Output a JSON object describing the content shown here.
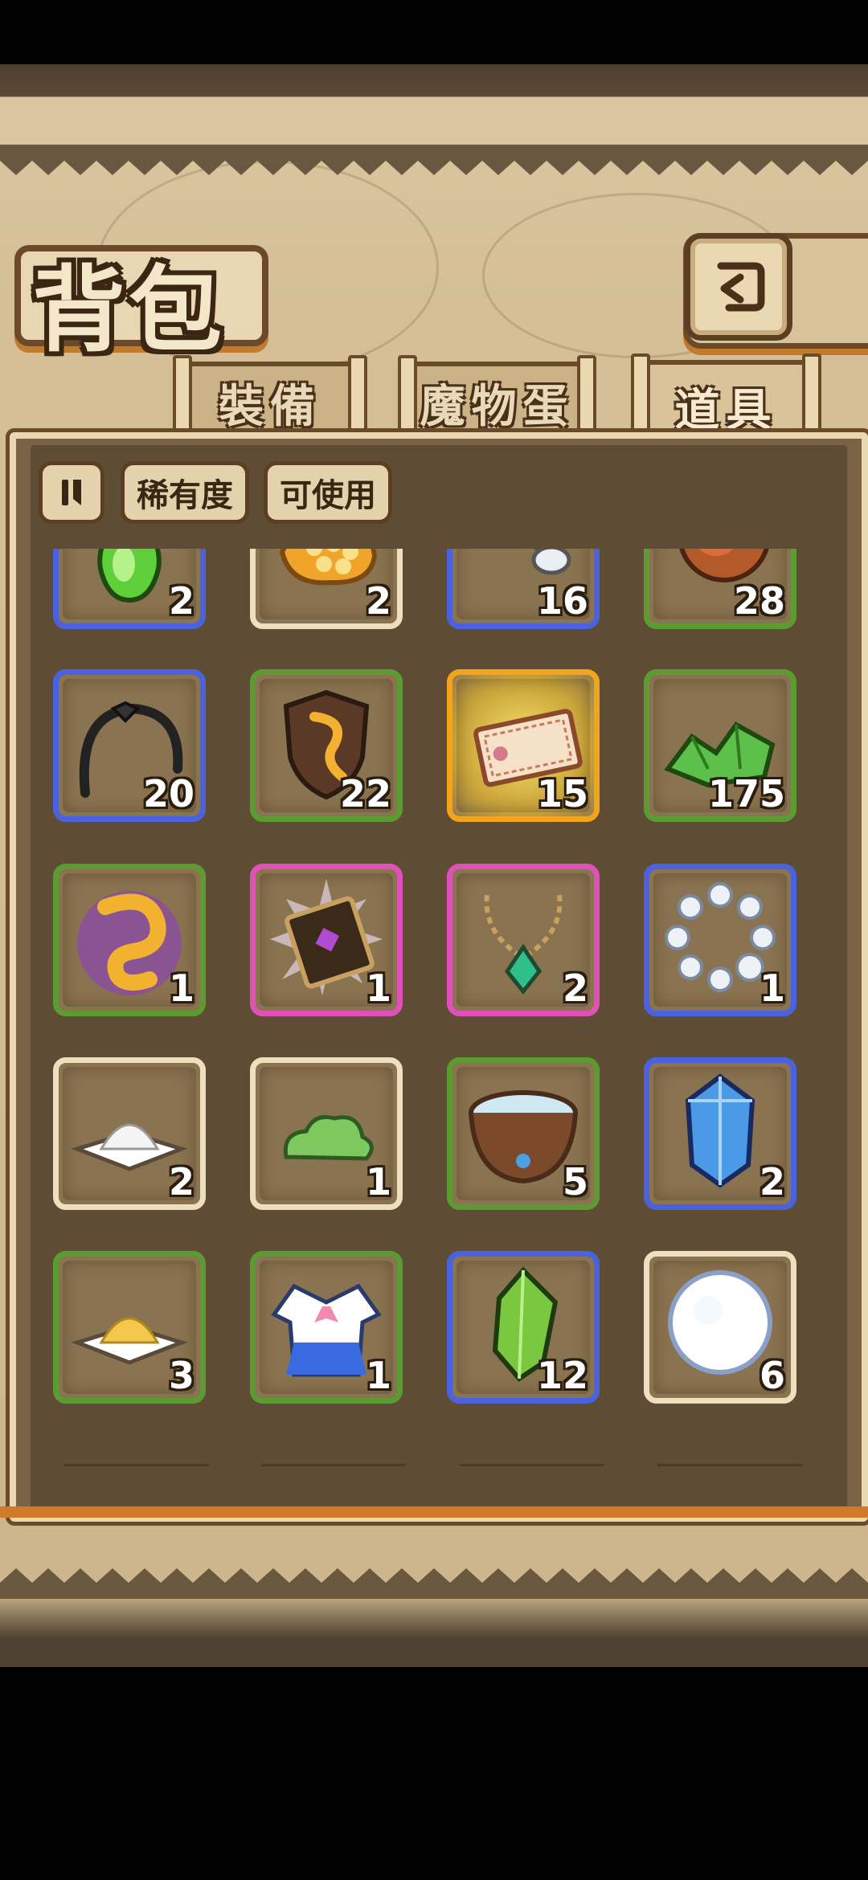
{
  "header": {
    "title": "背包",
    "back_icon": "return-arrow-icon"
  },
  "tabs": [
    {
      "label": "裝備",
      "active": false
    },
    {
      "label": "魔物蛋",
      "active": false
    },
    {
      "label": "道具",
      "active": true
    }
  ],
  "toolbar": {
    "pause_icon": "pause-sort-icon",
    "rarity_label": "稀有度",
    "usable_label": "可使用"
  },
  "rarity_colors": {
    "common": "#efe0bd",
    "uncommon": "#5c9b32",
    "rare": "#4a62e0",
    "epic": "#e051b8",
    "legendary": "#f2a51c"
  },
  "items": [
    {
      "icon": "green-gem-drop-icon",
      "qty": "2",
      "rarity": "rare"
    },
    {
      "icon": "honeycomb-icon",
      "qty": "2",
      "rarity": "common"
    },
    {
      "icon": "glasses-icon",
      "qty": "16",
      "rarity": "rare"
    },
    {
      "icon": "meat-slice-icon",
      "qty": "28",
      "rarity": "uncommon"
    },
    {
      "icon": "black-headband-icon",
      "qty": "20",
      "rarity": "rare"
    },
    {
      "icon": "dragon-shield-icon",
      "qty": "22",
      "rarity": "uncommon"
    },
    {
      "icon": "ticket-icon",
      "qty": "15",
      "rarity": "legendary"
    },
    {
      "icon": "green-crystals-icon",
      "qty": "175",
      "rarity": "uncommon"
    },
    {
      "icon": "golden-dragon-horn-icon",
      "qty": "1",
      "rarity": "uncommon"
    },
    {
      "icon": "magic-book-icon",
      "qty": "1",
      "rarity": "epic"
    },
    {
      "icon": "jade-necklace-icon",
      "qty": "2",
      "rarity": "epic"
    },
    {
      "icon": "pearl-bracelet-icon",
      "qty": "1",
      "rarity": "rare"
    },
    {
      "icon": "white-powder-icon",
      "qty": "2",
      "rarity": "common"
    },
    {
      "icon": "green-slime-icon",
      "qty": "1",
      "rarity": "common"
    },
    {
      "icon": "water-bowl-icon",
      "qty": "5",
      "rarity": "uncommon"
    },
    {
      "icon": "blue-crystal-icon",
      "qty": "2",
      "rarity": "rare"
    },
    {
      "icon": "yellow-powder-icon",
      "qty": "3",
      "rarity": "uncommon"
    },
    {
      "icon": "sailor-uniform-icon",
      "qty": "1",
      "rarity": "uncommon"
    },
    {
      "icon": "green-crystal-icon",
      "qty": "12",
      "rarity": "rare"
    },
    {
      "icon": "snowball-icon",
      "qty": "6",
      "rarity": "common"
    }
  ]
}
